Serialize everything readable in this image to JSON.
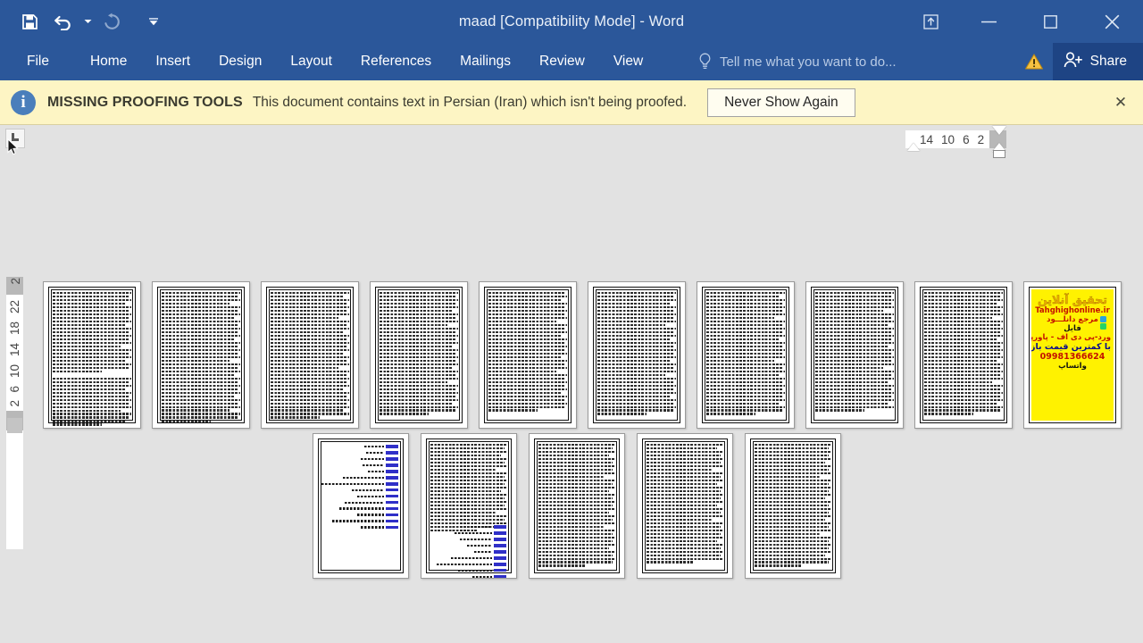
{
  "titlebar": {
    "title": "maad [Compatibility Mode] - Word",
    "quick_access": [
      {
        "name": "save",
        "icon": "save-icon",
        "label": "Save"
      },
      {
        "name": "undo",
        "icon": "undo-icon",
        "label": "Undo"
      },
      {
        "name": "undo-dropdown",
        "icon": "chevron-down-icon",
        "label": "Undo options"
      },
      {
        "name": "redo",
        "icon": "redo-icon",
        "label": "Repeat"
      },
      {
        "name": "customize",
        "icon": "customize-qat-icon",
        "label": "Customize Quick Access Toolbar"
      }
    ],
    "window_controls": [
      {
        "name": "ribbon-display-options",
        "icon": "ribbon-display-icon",
        "label": "Ribbon Display Options",
        "glyph": "⤒"
      },
      {
        "name": "minimize",
        "icon": "minimize-icon",
        "label": "Minimize",
        "glyph": "–"
      },
      {
        "name": "restore",
        "icon": "restore-icon",
        "label": "Restore Down",
        "glyph": "❐"
      },
      {
        "name": "close",
        "icon": "close-icon",
        "label": "Close",
        "glyph": "✕"
      }
    ]
  },
  "ribbon": {
    "tabs": [
      {
        "label": "File",
        "name": "tab-file"
      },
      {
        "label": "Home",
        "name": "tab-home"
      },
      {
        "label": "Insert",
        "name": "tab-insert"
      },
      {
        "label": "Design",
        "name": "tab-design"
      },
      {
        "label": "Layout",
        "name": "tab-layout"
      },
      {
        "label": "References",
        "name": "tab-references"
      },
      {
        "label": "Mailings",
        "name": "tab-mailings"
      },
      {
        "label": "Review",
        "name": "tab-review"
      },
      {
        "label": "View",
        "name": "tab-view"
      }
    ],
    "tell_me_placeholder": "Tell me what you want to do...",
    "warning_label": "!",
    "share_label": "Share"
  },
  "message_bar": {
    "info_glyph": "i",
    "heading": "MISSING PROOFING TOOLS",
    "body": "This document contains text in Persian (Iran) which isn't being proofed.",
    "button_label": "Never Show Again",
    "close_glyph": "✕",
    "background_color": "#fdf5c4"
  },
  "rulers": {
    "horizontal_ticks": [
      "14",
      "10",
      "6",
      "2"
    ],
    "vertical_ticks": [
      "2",
      "6",
      "10",
      "14",
      "18",
      "22"
    ],
    "vertical_top_tick": "2",
    "tab_selector_label": "Left Tab"
  },
  "document": {
    "zoom_view": "multiple-pages",
    "background_color": "#e2e2e2",
    "row1_pages": [
      {
        "name": "page-thumbnail",
        "kind": "text"
      },
      {
        "name": "page-thumbnail",
        "kind": "text"
      },
      {
        "name": "page-thumbnail",
        "kind": "text"
      },
      {
        "name": "page-thumbnail",
        "kind": "text"
      },
      {
        "name": "page-thumbnail",
        "kind": "text"
      },
      {
        "name": "page-thumbnail",
        "kind": "text"
      },
      {
        "name": "page-thumbnail",
        "kind": "text"
      },
      {
        "name": "page-thumbnail",
        "kind": "text"
      },
      {
        "name": "page-thumbnail",
        "kind": "text"
      },
      {
        "name": "page-thumbnail",
        "kind": "advert"
      }
    ],
    "row2_pages": [
      {
        "name": "page-thumbnail",
        "kind": "toc"
      },
      {
        "name": "page-thumbnail",
        "kind": "text-toc"
      },
      {
        "name": "page-thumbnail",
        "kind": "text"
      },
      {
        "name": "page-thumbnail",
        "kind": "text"
      },
      {
        "name": "page-thumbnail",
        "kind": "text"
      }
    ],
    "advert_page": {
      "background_color": "#fff200",
      "title": "تحقیق آنلاین",
      "url": "Tahghighonline.ir",
      "line_reference": "مرجع دانلـــود",
      "line_file": "فایل",
      "line_formats": "ورد-پی دی اف - پاورپوینت",
      "line_price": "با کمترین قیمت بازار",
      "phone": "09981366624",
      "whatsapp": "واتساپ"
    }
  },
  "colors": {
    "word_blue": "#2b579a",
    "share_blue": "#1e4484",
    "message_yellow": "#fdf5c4",
    "workspace_gray": "#e2e2e2",
    "advert_yellow": "#fff200"
  }
}
